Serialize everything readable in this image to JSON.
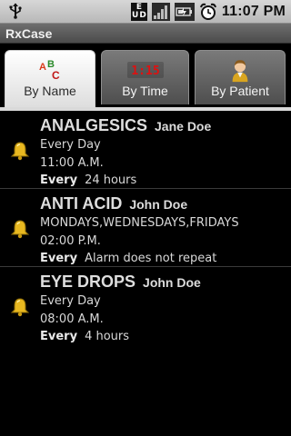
{
  "status_bar": {
    "time": "11:07 PM",
    "icons": [
      "usb-icon",
      "eud-icon",
      "signal-icon",
      "battery-icon",
      "alarm-clock-icon"
    ],
    "eud_text": [
      "E",
      "U",
      "D"
    ]
  },
  "app": {
    "title": "RxCase"
  },
  "tabs": [
    {
      "label": "By Name",
      "icon": "abc-icon",
      "icon_text": [
        "A",
        "B",
        "C"
      ],
      "active": true
    },
    {
      "label": "By Time",
      "icon": "clock-icon",
      "icon_text": "1:15",
      "active": false
    },
    {
      "label": "By Patient",
      "icon": "patient-icon",
      "active": false
    }
  ],
  "colors": {
    "icon_time_red": "#e01010",
    "abc_a": "#d93a1a",
    "abc_b": "#2a8a2a",
    "abc_c": "#c01818",
    "bell": "#e8b820"
  },
  "meds": [
    {
      "name": "ANALGESICS",
      "patient": "Jane Doe",
      "schedule": "Every Day",
      "time": "11:00 A.M.",
      "every_label": "Every",
      "every_value": "24 hours"
    },
    {
      "name": "ANTI ACID",
      "patient": "John Doe",
      "schedule": "MONDAYS,WEDNESDAYS,FRIDAYS",
      "time": "02:00 P.M.",
      "every_label": "Every",
      "every_value": "Alarm does not repeat"
    },
    {
      "name": "EYE DROPS",
      "patient": "John Doe",
      "schedule": "Every Day",
      "time": "08:00 A.M.",
      "every_label": "Every",
      "every_value": "4 hours"
    }
  ]
}
